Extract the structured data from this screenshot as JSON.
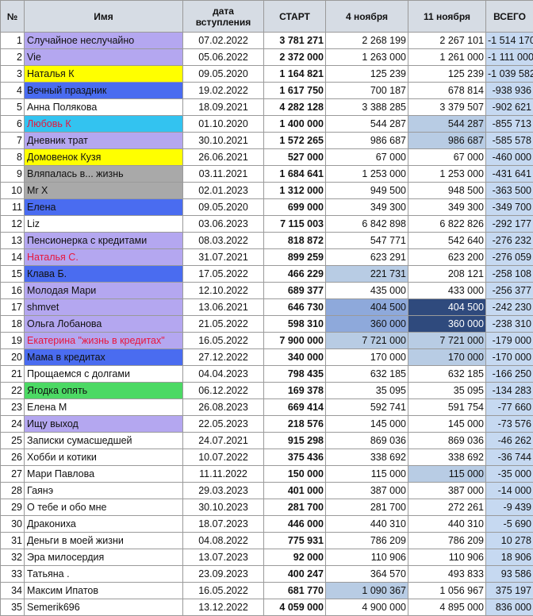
{
  "table": {
    "headers": {
      "num": "№",
      "name": "Имя",
      "date_line1": "дата",
      "date_line2": "вступления",
      "start": "СТАРТ",
      "nov4": "4 ноября",
      "nov11": "11 ноября",
      "total": "ВСЕГО"
    },
    "rows": [
      {
        "n": "1",
        "name": "Случайное неслучайно",
        "date": "07.02.2022",
        "start": "3 781 271",
        "nov4": "2 268 199",
        "nov11": "2 267 101",
        "total": "-1 514 170",
        "name_bg": "#b4a7f0",
        "name_color": "#111111",
        "nov4_bg": "#ffffff",
        "nov11_bg": "#ffffff",
        "nov11_color": "#111111"
      },
      {
        "n": "2",
        "name": "Vie",
        "date": "05.06.2022",
        "start": "2 372 000",
        "nov4": "1 263 000",
        "nov11": "1 261 000",
        "total": "-1 111 000",
        "name_bg": "#b4a7f0",
        "name_color": "#111111",
        "nov4_bg": "#ffffff",
        "nov11_bg": "#ffffff",
        "nov11_color": "#111111"
      },
      {
        "n": "3",
        "name": "Наталья К",
        "date": "09.05.2020",
        "start": "1 164 821",
        "nov4": "125 239",
        "nov11": "125 239",
        "total": "-1 039 582",
        "name_bg": "#ffff00",
        "name_color": "#111111",
        "nov4_bg": "#ffffff",
        "nov11_bg": "#ffffff",
        "nov11_color": "#111111"
      },
      {
        "n": "4",
        "name": "Вечный праздник",
        "date": "19.02.2022",
        "start": "1 617 750",
        "nov4": "700 187",
        "nov11": "678 814",
        "total": "-938 936",
        "name_bg": "#4a6cf0",
        "name_color": "#111111",
        "nov4_bg": "#ffffff",
        "nov11_bg": "#ffffff",
        "nov11_color": "#111111"
      },
      {
        "n": "5",
        "name": "Анна Полякова",
        "date": "18.09.2021",
        "start": "4 282 128",
        "nov4": "3 388 285",
        "nov11": "3 379 507",
        "total": "-902 621",
        "name_bg": "#ffffff",
        "name_color": "#111111",
        "nov4_bg": "#ffffff",
        "nov11_bg": "#ffffff",
        "nov11_color": "#111111"
      },
      {
        "n": "6",
        "name": "Любовь К",
        "date": "01.10.2020",
        "start": "1 400 000",
        "nov4": "544 287",
        "nov11": "544 287",
        "total": "-855 713",
        "name_bg": "#33c3f0",
        "name_color": "#e8163c",
        "nov4_bg": "#ffffff",
        "nov11_bg": "#b8cce4",
        "nov11_color": "#111111"
      },
      {
        "n": "7",
        "name": "Дневник трат",
        "date": "30.10.2021",
        "start": "1 572 265",
        "nov4": "986 687",
        "nov11": "986 687",
        "total": "-585 578",
        "name_bg": "#b4a7f0",
        "name_color": "#111111",
        "nov4_bg": "#ffffff",
        "nov11_bg": "#b8cce4",
        "nov11_color": "#111111"
      },
      {
        "n": "8",
        "name": "Домовенок Кузя",
        "date": "26.06.2021",
        "start": "527 000",
        "nov4": "67 000",
        "nov11": "67 000",
        "total": "-460 000",
        "name_bg": "#ffff00",
        "name_color": "#111111",
        "nov4_bg": "#ffffff",
        "nov11_bg": "#ffffff",
        "nov11_color": "#111111"
      },
      {
        "n": "9",
        "name": "Вляпалась в... жизнь",
        "date": "03.11.2021",
        "start": "1 684 641",
        "nov4": "1 253 000",
        "nov11": "1 253 000",
        "total": "-431 641",
        "name_bg": "#a9a9a9",
        "name_color": "#111111",
        "nov4_bg": "#ffffff",
        "nov11_bg": "#ffffff",
        "nov11_color": "#111111"
      },
      {
        "n": "10",
        "name": "Mr X",
        "date": "02.01.2023",
        "start": "1 312 000",
        "nov4": "949 500",
        "nov11": "948 500",
        "total": "-363 500",
        "name_bg": "#a9a9a9",
        "name_color": "#111111",
        "nov4_bg": "#ffffff",
        "nov11_bg": "#ffffff",
        "nov11_color": "#111111"
      },
      {
        "n": "11",
        "name": "Елена",
        "date": "09.05.2020",
        "start": "699 000",
        "nov4": "349 300",
        "nov11": "349 300",
        "total": "-349 700",
        "name_bg": "#4a6cf0",
        "name_color": "#111111",
        "nov4_bg": "#ffffff",
        "nov11_bg": "#ffffff",
        "nov11_color": "#111111"
      },
      {
        "n": "12",
        "name": "Liz",
        "date": "03.06.2023",
        "start": "7 115 003",
        "nov4": "6 842 898",
        "nov11": "6 822 826",
        "total": "-292 177",
        "name_bg": "#ffffff",
        "name_color": "#111111",
        "nov4_bg": "#ffffff",
        "nov11_bg": "#ffffff",
        "nov11_color": "#111111"
      },
      {
        "n": "13",
        "name": "Пенсионерка с кредитами",
        "date": "08.03.2022",
        "start": "818 872",
        "nov4": "547 771",
        "nov11": "542 640",
        "total": "-276 232",
        "name_bg": "#b4a7f0",
        "name_color": "#111111",
        "nov4_bg": "#ffffff",
        "nov11_bg": "#ffffff",
        "nov11_color": "#111111"
      },
      {
        "n": "14",
        "name": "Наталья С.",
        "date": "31.07.2021",
        "start": "899 259",
        "nov4": "623 291",
        "nov11": "623 200",
        "total": "-276 059",
        "name_bg": "#b4a7f0",
        "name_color": "#e8163c",
        "nov4_bg": "#ffffff",
        "nov11_bg": "#ffffff",
        "nov11_color": "#111111"
      },
      {
        "n": "15",
        "name": "Клава Б.",
        "date": "17.05.2022",
        "start": "466 229",
        "nov4": "221 731",
        "nov11": "208 121",
        "total": "-258 108",
        "name_bg": "#4a6cf0",
        "name_color": "#111111",
        "nov4_bg": "#b8cce4",
        "nov11_bg": "#ffffff",
        "nov11_color": "#111111"
      },
      {
        "n": "16",
        "name": "Молодая Мари",
        "date": "12.10.2022",
        "start": "689 377",
        "nov4": "435 000",
        "nov11": "433 000",
        "total": "-256 377",
        "name_bg": "#b4a7f0",
        "name_color": "#111111",
        "nov4_bg": "#ffffff",
        "nov11_bg": "#ffffff",
        "nov11_color": "#111111"
      },
      {
        "n": "17",
        "name": "shmvet",
        "date": "13.06.2021",
        "start": "646 730",
        "nov4": "404 500",
        "nov11": "404 500",
        "total": "-242 230",
        "name_bg": "#b4a7f0",
        "name_color": "#111111",
        "nov4_bg": "#8ea9db",
        "nov11_bg": "#2f4a7d",
        "nov11_color": "#ffffff"
      },
      {
        "n": "18",
        "name": "Ольга Лобанова",
        "date": "21.05.2022",
        "start": "598 310",
        "nov4": "360 000",
        "nov11": "360 000",
        "total": "-238 310",
        "name_bg": "#b4a7f0",
        "name_color": "#111111",
        "nov4_bg": "#8ea9db",
        "nov11_bg": "#2f4a7d",
        "nov11_color": "#ffffff"
      },
      {
        "n": "19",
        "name": "Екатерина \"жизнь в кредитах\"",
        "date": "16.05.2022",
        "start": "7 900 000",
        "nov4": "7 721 000",
        "nov11": "7 721 000",
        "total": "-179 000",
        "name_bg": "#b4a7f0",
        "name_color": "#e8163c",
        "nov4_bg": "#b8cce4",
        "nov11_bg": "#b8cce4",
        "nov11_color": "#111111"
      },
      {
        "n": "20",
        "name": "Мама в кредитах",
        "date": "27.12.2022",
        "start": "340 000",
        "nov4": "170 000",
        "nov11": "170 000",
        "total": "-170 000",
        "name_bg": "#4a6cf0",
        "name_color": "#111111",
        "nov4_bg": "#ffffff",
        "nov11_bg": "#b8cce4",
        "nov11_color": "#111111"
      },
      {
        "n": "21",
        "name": "Прощаемся с долгами",
        "date": "04.04.2023",
        "start": "798 435",
        "nov4": "632 185",
        "nov11": "632 185",
        "total": "-166 250",
        "name_bg": "#ffffff",
        "name_color": "#111111",
        "nov4_bg": "#ffffff",
        "nov11_bg": "#ffffff",
        "nov11_color": "#111111"
      },
      {
        "n": "22",
        "name": "Ягодка опять",
        "date": "06.12.2022",
        "start": "169 378",
        "nov4": "35 095",
        "nov11": "35 095",
        "total": "-134 283",
        "name_bg": "#4cd964",
        "name_color": "#111111",
        "nov4_bg": "#ffffff",
        "nov11_bg": "#ffffff",
        "nov11_color": "#111111"
      },
      {
        "n": "23",
        "name": "Елена М",
        "date": "26.08.2023",
        "start": "669 414",
        "nov4": "592 741",
        "nov11": "591 754",
        "total": "-77 660",
        "name_bg": "#ffffff",
        "name_color": "#111111",
        "nov4_bg": "#ffffff",
        "nov11_bg": "#ffffff",
        "nov11_color": "#111111"
      },
      {
        "n": "24",
        "name": "Ищу выход",
        "date": "22.05.2023",
        "start": "218 576",
        "nov4": "145 000",
        "nov11": "145 000",
        "total": "-73 576",
        "name_bg": "#b4a7f0",
        "name_color": "#111111",
        "nov4_bg": "#ffffff",
        "nov11_bg": "#ffffff",
        "nov11_color": "#111111"
      },
      {
        "n": "25",
        "name": "Записки сумасшедшей",
        "date": "24.07.2021",
        "start": "915 298",
        "nov4": "869 036",
        "nov11": "869 036",
        "total": "-46 262",
        "name_bg": "#ffffff",
        "name_color": "#111111",
        "nov4_bg": "#ffffff",
        "nov11_bg": "#ffffff",
        "nov11_color": "#111111"
      },
      {
        "n": "26",
        "name": "Хобби и котики",
        "date": "10.07.2022",
        "start": "375 436",
        "nov4": "338 692",
        "nov11": "338 692",
        "total": "-36 744",
        "name_bg": "#ffffff",
        "name_color": "#111111",
        "nov4_bg": "#ffffff",
        "nov11_bg": "#ffffff",
        "nov11_color": "#111111"
      },
      {
        "n": "27",
        "name": "Мари Павлова",
        "date": "11.11.2022",
        "start": "150 000",
        "nov4": "115 000",
        "nov11": "115 000",
        "total": "-35 000",
        "name_bg": "#ffffff",
        "name_color": "#111111",
        "nov4_bg": "#ffffff",
        "nov11_bg": "#b8cce4",
        "nov11_color": "#111111"
      },
      {
        "n": "28",
        "name": "Гаянэ",
        "date": "29.03.2023",
        "start": "401 000",
        "nov4": "387 000",
        "nov11": "387 000",
        "total": "-14 000",
        "name_bg": "#ffffff",
        "name_color": "#111111",
        "nov4_bg": "#ffffff",
        "nov11_bg": "#ffffff",
        "nov11_color": "#111111"
      },
      {
        "n": "29",
        "name": "О тебе и обо мне",
        "date": "30.10.2023",
        "start": "281 700",
        "nov4": "281 700",
        "nov11": "272 261",
        "total": "-9 439",
        "name_bg": "#ffffff",
        "name_color": "#111111",
        "nov4_bg": "#ffffff",
        "nov11_bg": "#ffffff",
        "nov11_color": "#111111"
      },
      {
        "n": "30",
        "name": "Дракониха",
        "date": "18.07.2023",
        "start": "446 000",
        "nov4": "440 310",
        "nov11": "440 310",
        "total": "-5 690",
        "name_bg": "#ffffff",
        "name_color": "#111111",
        "nov4_bg": "#ffffff",
        "nov11_bg": "#ffffff",
        "nov11_color": "#111111"
      },
      {
        "n": "31",
        "name": "Деньги в моей жизни",
        "date": "04.08.2022",
        "start": "775 931",
        "nov4": "786 209",
        "nov11": "786 209",
        "total": "10 278",
        "name_bg": "#ffffff",
        "name_color": "#111111",
        "nov4_bg": "#ffffff",
        "nov11_bg": "#ffffff",
        "nov11_color": "#111111"
      },
      {
        "n": "32",
        "name": "Эра милосердия",
        "date": "13.07.2023",
        "start": "92 000",
        "nov4": "110 906",
        "nov11": "110 906",
        "total": "18 906",
        "name_bg": "#ffffff",
        "name_color": "#111111",
        "nov4_bg": "#ffffff",
        "nov11_bg": "#ffffff",
        "nov11_color": "#111111"
      },
      {
        "n": "33",
        "name": "Татьяна .",
        "date": "23.09.2023",
        "start": "400 247",
        "nov4": "364 570",
        "nov11": "493 833",
        "total": "93 586",
        "name_bg": "#ffffff",
        "name_color": "#111111",
        "nov4_bg": "#ffffff",
        "nov11_bg": "#ffffff",
        "nov11_color": "#111111"
      },
      {
        "n": "34",
        "name": "Максим Ипатов",
        "date": "16.05.2022",
        "start": "681 770",
        "nov4": "1 090 367",
        "nov11": "1 056 967",
        "total": "375 197",
        "name_bg": "#ffffff",
        "name_color": "#111111",
        "nov4_bg": "#b8cce4",
        "nov11_bg": "#ffffff",
        "nov11_color": "#111111"
      },
      {
        "n": "35",
        "name": "Semerik696",
        "date": "13.12.2022",
        "start": "4 059 000",
        "nov4": "4 900 000",
        "nov11": "4 895 000",
        "total": "836 000",
        "name_bg": "#ffffff",
        "name_color": "#111111",
        "nov4_bg": "#ffffff",
        "nov11_bg": "#ffffff",
        "nov11_color": "#111111"
      }
    ]
  }
}
